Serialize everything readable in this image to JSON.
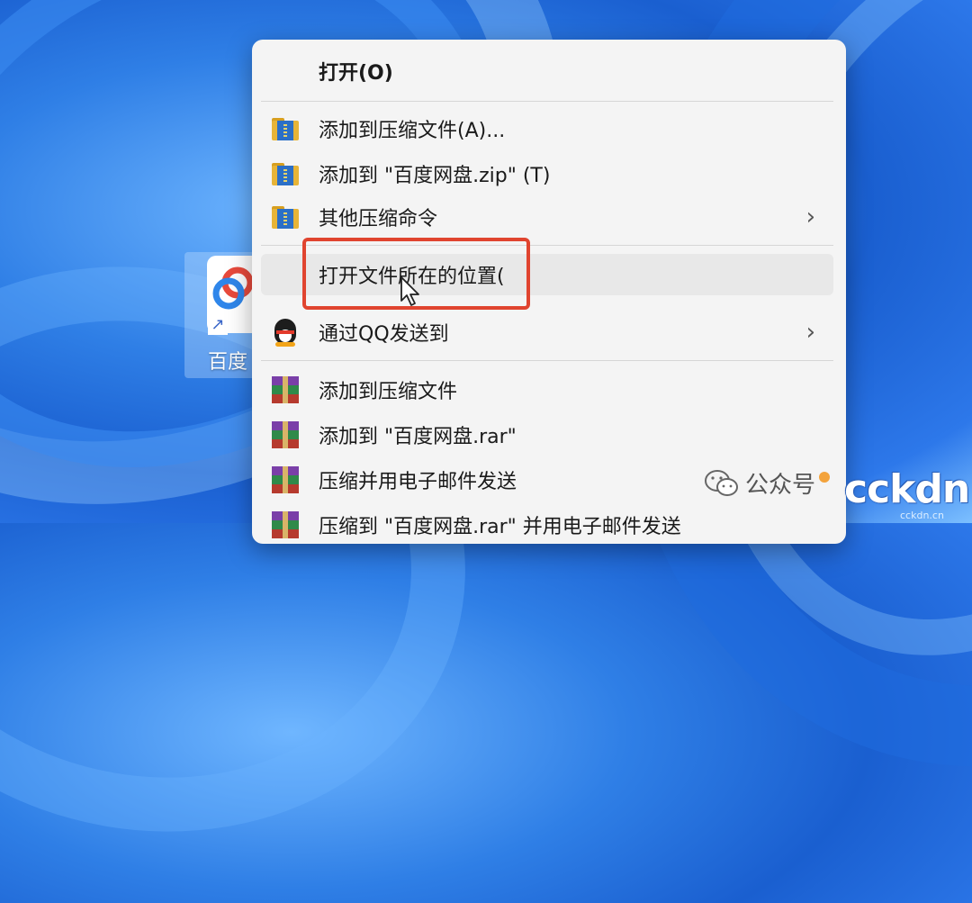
{
  "desktop": {
    "icon_label": "百度"
  },
  "menu": {
    "items": [
      {
        "label": "打开(O)",
        "icon": "none",
        "bold": true,
        "submenu": false
      },
      {
        "label": "添加到压缩文件(A)...",
        "icon": "zip-folder-icon",
        "submenu": false
      },
      {
        "label": "添加到 \"百度网盘.zip\" (T)",
        "icon": "zip-folder-icon",
        "submenu": false
      },
      {
        "label": "其他压缩命令",
        "icon": "zip-folder-icon",
        "submenu": true
      },
      {
        "label": "打开文件所在的位置(",
        "icon": "none",
        "submenu": false,
        "hovered": true
      },
      {
        "label": "通过QQ发送到",
        "icon": "qq-penguin-icon",
        "submenu": true
      },
      {
        "label": "添加到压缩文件",
        "icon": "winrar-icon",
        "submenu": false
      },
      {
        "label": "添加到 \"百度网盘.rar\"",
        "icon": "winrar-icon",
        "submenu": false
      },
      {
        "label": "压缩并用电子邮件发送",
        "icon": "winrar-icon",
        "submenu": false
      },
      {
        "label": "压缩到 \"百度网盘.rar\" 并用电子邮件发送",
        "icon": "winrar-icon",
        "submenu": false
      }
    ],
    "submenu_glyph": "›"
  },
  "highlight_color": "#e0442f",
  "watermark": {
    "wechat_text": "公众号",
    "site_logo": "cckdn",
    "site_url": "cckdn.cn"
  }
}
